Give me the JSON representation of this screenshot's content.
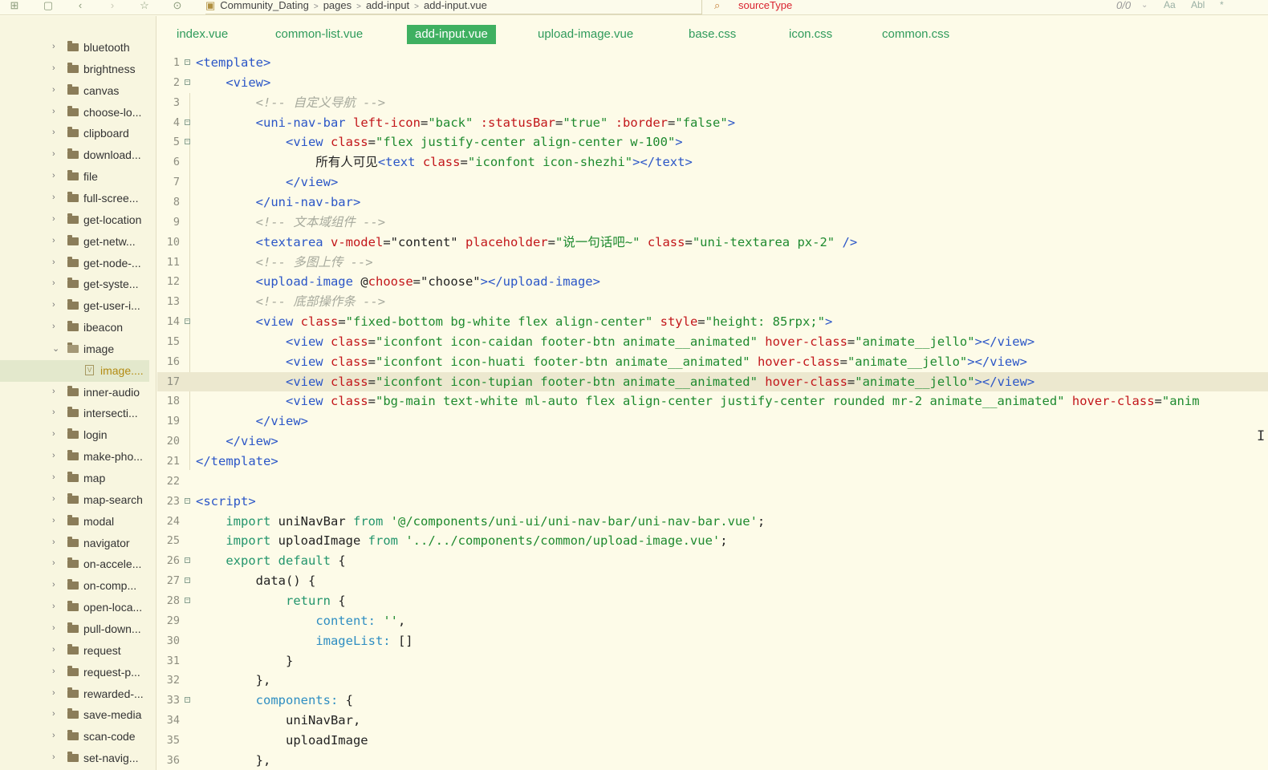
{
  "breadcrumb": [
    "Community_Dating",
    "pages",
    "add-input",
    "add-input.vue"
  ],
  "search": {
    "query": "sourceType",
    "count": "0/0",
    "options": [
      "Aa",
      "Abl",
      "*"
    ]
  },
  "sidebar": {
    "items": [
      {
        "label": "bluetooth",
        "type": "folder",
        "expanded": false
      },
      {
        "label": "brightness",
        "type": "folder",
        "expanded": false
      },
      {
        "label": "canvas",
        "type": "folder",
        "expanded": false
      },
      {
        "label": "choose-lo...",
        "type": "folder",
        "expanded": false
      },
      {
        "label": "clipboard",
        "type": "folder",
        "expanded": false
      },
      {
        "label": "download...",
        "type": "folder",
        "expanded": false
      },
      {
        "label": "file",
        "type": "folder",
        "expanded": false
      },
      {
        "label": "full-scree...",
        "type": "folder",
        "expanded": false
      },
      {
        "label": "get-location",
        "type": "folder",
        "expanded": false
      },
      {
        "label": "get-netw...",
        "type": "folder",
        "expanded": false
      },
      {
        "label": "get-node-...",
        "type": "folder",
        "expanded": false
      },
      {
        "label": "get-syste...",
        "type": "folder",
        "expanded": false
      },
      {
        "label": "get-user-i...",
        "type": "folder",
        "expanded": false
      },
      {
        "label": "ibeacon",
        "type": "folder",
        "expanded": false
      },
      {
        "label": "image",
        "type": "folder",
        "expanded": true
      },
      {
        "label": "image....",
        "type": "file",
        "selected": true
      },
      {
        "label": "inner-audio",
        "type": "folder",
        "expanded": false
      },
      {
        "label": "intersecti...",
        "type": "folder",
        "expanded": false
      },
      {
        "label": "login",
        "type": "folder",
        "expanded": false
      },
      {
        "label": "make-pho...",
        "type": "folder",
        "expanded": false
      },
      {
        "label": "map",
        "type": "folder",
        "expanded": false
      },
      {
        "label": "map-search",
        "type": "folder",
        "expanded": false
      },
      {
        "label": "modal",
        "type": "folder",
        "expanded": false
      },
      {
        "label": "navigator",
        "type": "folder",
        "expanded": false
      },
      {
        "label": "on-accele...",
        "type": "folder",
        "expanded": false
      },
      {
        "label": "on-comp...",
        "type": "folder",
        "expanded": false
      },
      {
        "label": "open-loca...",
        "type": "folder",
        "expanded": false
      },
      {
        "label": "pull-down...",
        "type": "folder",
        "expanded": false
      },
      {
        "label": "request",
        "type": "folder",
        "expanded": false
      },
      {
        "label": "request-p...",
        "type": "folder",
        "expanded": false
      },
      {
        "label": "rewarded-...",
        "type": "folder",
        "expanded": false
      },
      {
        "label": "save-media",
        "type": "folder",
        "expanded": false
      },
      {
        "label": "scan-code",
        "type": "folder",
        "expanded": false
      },
      {
        "label": "set-navig...",
        "type": "folder",
        "expanded": false
      }
    ]
  },
  "tabs": [
    {
      "label": "index.vue",
      "active": false
    },
    {
      "label": "common-list.vue",
      "active": false
    },
    {
      "label": "add-input.vue",
      "active": true
    },
    {
      "label": "upload-image.vue",
      "active": false
    },
    {
      "label": "base.css",
      "active": false
    },
    {
      "label": "icon.css",
      "active": false
    },
    {
      "label": "common.css",
      "active": false
    }
  ],
  "editor": {
    "current_line": 17,
    "lines": [
      {
        "n": "1",
        "fold": true,
        "tokens": [
          [
            "t",
            "<template>"
          ]
        ]
      },
      {
        "n": "2",
        "fold": true,
        "tokens": [
          [
            "x",
            "    "
          ],
          [
            "t",
            "<view>"
          ]
        ]
      },
      {
        "n": "3",
        "fold": false,
        "tokens": [
          [
            "x",
            "        "
          ],
          [
            "c",
            "<!-- 自定义导航 -->"
          ]
        ]
      },
      {
        "n": "4",
        "fold": true,
        "tokens": [
          [
            "x",
            "        "
          ],
          [
            "t",
            "<uni-nav-bar "
          ],
          [
            "a",
            "left-icon"
          ],
          [
            "x",
            "="
          ],
          [
            "s",
            "\"back\""
          ],
          [
            "x",
            " "
          ],
          [
            "a",
            ":statusBar"
          ],
          [
            "x",
            "="
          ],
          [
            "s",
            "\"true\""
          ],
          [
            "x",
            " "
          ],
          [
            "a",
            ":border"
          ],
          [
            "x",
            "="
          ],
          [
            "s",
            "\"false\""
          ],
          [
            "t",
            ">"
          ]
        ]
      },
      {
        "n": "5",
        "fold": true,
        "tokens": [
          [
            "x",
            "            "
          ],
          [
            "t",
            "<view "
          ],
          [
            "a",
            "class"
          ],
          [
            "x",
            "="
          ],
          [
            "s",
            "\"flex justify-center align-center w-100\""
          ],
          [
            "t",
            ">"
          ]
        ]
      },
      {
        "n": "6",
        "fold": false,
        "tokens": [
          [
            "x",
            "                所有人可见"
          ],
          [
            "t",
            "<text "
          ],
          [
            "a",
            "class"
          ],
          [
            "x",
            "="
          ],
          [
            "s",
            "\"iconfont icon-shezhi\""
          ],
          [
            "t",
            "></text>"
          ]
        ]
      },
      {
        "n": "7",
        "fold": false,
        "tokens": [
          [
            "x",
            "            "
          ],
          [
            "t",
            "</view>"
          ]
        ]
      },
      {
        "n": "8",
        "fold": false,
        "tokens": [
          [
            "x",
            "        "
          ],
          [
            "t",
            "</uni-nav-bar>"
          ]
        ]
      },
      {
        "n": "9",
        "fold": false,
        "tokens": [
          [
            "x",
            "        "
          ],
          [
            "c",
            "<!-- 文本域组件 -->"
          ]
        ]
      },
      {
        "n": "10",
        "fold": false,
        "tokens": [
          [
            "x",
            "        "
          ],
          [
            "t",
            "<textarea "
          ],
          [
            "a",
            "v-model"
          ],
          [
            "x",
            "=\"content\" "
          ],
          [
            "a",
            "placeholder"
          ],
          [
            "x",
            "="
          ],
          [
            "s",
            "\"说一句话吧~\""
          ],
          [
            "x",
            " "
          ],
          [
            "a",
            "class"
          ],
          [
            "x",
            "="
          ],
          [
            "s",
            "\"uni-textarea px-2\""
          ],
          [
            "x",
            " "
          ],
          [
            "t",
            "/>"
          ]
        ]
      },
      {
        "n": "11",
        "fold": false,
        "tokens": [
          [
            "x",
            "        "
          ],
          [
            "c",
            "<!-- 多图上传 -->"
          ]
        ]
      },
      {
        "n": "12",
        "fold": false,
        "tokens": [
          [
            "x",
            "        "
          ],
          [
            "t",
            "<upload-image "
          ],
          [
            "x",
            "@"
          ],
          [
            "a",
            "choose"
          ],
          [
            "x",
            "=\"choose\""
          ],
          [
            "t",
            "></upload-image>"
          ]
        ]
      },
      {
        "n": "13",
        "fold": false,
        "tokens": [
          [
            "x",
            "        "
          ],
          [
            "c",
            "<!-- 底部操作条 -->"
          ]
        ]
      },
      {
        "n": "14",
        "fold": true,
        "tokens": [
          [
            "x",
            "        "
          ],
          [
            "t",
            "<view "
          ],
          [
            "a",
            "class"
          ],
          [
            "x",
            "="
          ],
          [
            "s",
            "\"fixed-bottom bg-white flex align-center\""
          ],
          [
            "x",
            " "
          ],
          [
            "a",
            "style"
          ],
          [
            "x",
            "="
          ],
          [
            "s",
            "\"height: 85rpx;\""
          ],
          [
            "t",
            ">"
          ]
        ]
      },
      {
        "n": "15",
        "fold": false,
        "tokens": [
          [
            "x",
            "            "
          ],
          [
            "t",
            "<view "
          ],
          [
            "a",
            "class"
          ],
          [
            "x",
            "="
          ],
          [
            "s",
            "\"iconfont icon-caidan footer-btn animate__animated\""
          ],
          [
            "x",
            " "
          ],
          [
            "a",
            "hover-class"
          ],
          [
            "x",
            "="
          ],
          [
            "s",
            "\"animate__jello\""
          ],
          [
            "t",
            "></view>"
          ]
        ]
      },
      {
        "n": "16",
        "fold": false,
        "tokens": [
          [
            "x",
            "            "
          ],
          [
            "t",
            "<view "
          ],
          [
            "a",
            "class"
          ],
          [
            "x",
            "="
          ],
          [
            "s",
            "\"iconfont icon-huati footer-btn animate__animated\""
          ],
          [
            "x",
            " "
          ],
          [
            "a",
            "hover-class"
          ],
          [
            "x",
            "="
          ],
          [
            "s",
            "\"animate__jello\""
          ],
          [
            "t",
            "></view>"
          ]
        ]
      },
      {
        "n": "17",
        "fold": false,
        "tokens": [
          [
            "x",
            "            "
          ],
          [
            "t",
            "<view "
          ],
          [
            "a",
            "class"
          ],
          [
            "x",
            "="
          ],
          [
            "s",
            "\"iconfont icon-tupian footer-btn animate__animated\""
          ],
          [
            "x",
            " "
          ],
          [
            "a",
            "hover-class"
          ],
          [
            "x",
            "="
          ],
          [
            "s",
            "\"animate__jello\""
          ],
          [
            "t",
            "></view>"
          ]
        ]
      },
      {
        "n": "18",
        "fold": false,
        "tokens": [
          [
            "x",
            "            "
          ],
          [
            "t",
            "<view "
          ],
          [
            "a",
            "class"
          ],
          [
            "x",
            "="
          ],
          [
            "s",
            "\"bg-main text-white ml-auto flex align-center justify-center rounded mr-2 animate__animated\""
          ],
          [
            "x",
            " "
          ],
          [
            "a",
            "hover-class"
          ],
          [
            "x",
            "="
          ],
          [
            "s",
            "\"anim"
          ]
        ]
      },
      {
        "n": "19",
        "fold": false,
        "tokens": [
          [
            "x",
            "        "
          ],
          [
            "t",
            "</view>"
          ]
        ]
      },
      {
        "n": "20",
        "fold": false,
        "tokens": [
          [
            "x",
            "    "
          ],
          [
            "t",
            "</view>"
          ]
        ]
      },
      {
        "n": "21",
        "fold": false,
        "tokens": [
          [
            "t",
            "</template>"
          ]
        ]
      },
      {
        "n": "22",
        "fold": false,
        "tokens": []
      },
      {
        "n": "23",
        "fold": true,
        "tokens": [
          [
            "t",
            "<script>"
          ]
        ]
      },
      {
        "n": "24",
        "fold": false,
        "tokens": [
          [
            "x",
            "    "
          ],
          [
            "k",
            "import"
          ],
          [
            "x",
            " uniNavBar "
          ],
          [
            "k",
            "from"
          ],
          [
            "x",
            " "
          ],
          [
            "s",
            "'@/components/uni-ui/uni-nav-bar/uni-nav-bar.vue'"
          ],
          [
            "x",
            ";"
          ]
        ]
      },
      {
        "n": "25",
        "fold": false,
        "tokens": [
          [
            "x",
            "    "
          ],
          [
            "k",
            "import"
          ],
          [
            "x",
            " uploadImage "
          ],
          [
            "k",
            "from"
          ],
          [
            "x",
            " "
          ],
          [
            "s",
            "'../../components/common/upload-image.vue'"
          ],
          [
            "x",
            ";"
          ]
        ]
      },
      {
        "n": "26",
        "fold": true,
        "tokens": [
          [
            "x",
            "    "
          ],
          [
            "k",
            "export default"
          ],
          [
            "x",
            " {"
          ]
        ]
      },
      {
        "n": "27",
        "fold": true,
        "tokens": [
          [
            "x",
            "        data() {"
          ]
        ]
      },
      {
        "n": "28",
        "fold": true,
        "tokens": [
          [
            "x",
            "            "
          ],
          [
            "k",
            "return"
          ],
          [
            "x",
            " {"
          ]
        ]
      },
      {
        "n": "29",
        "fold": false,
        "tokens": [
          [
            "x",
            "                "
          ],
          [
            "p",
            "content:"
          ],
          [
            "x",
            " "
          ],
          [
            "s",
            "''"
          ],
          [
            "x",
            ","
          ]
        ]
      },
      {
        "n": "30",
        "fold": false,
        "tokens": [
          [
            "x",
            "                "
          ],
          [
            "p",
            "imageList:"
          ],
          [
            "x",
            " []"
          ]
        ]
      },
      {
        "n": "31",
        "fold": false,
        "tokens": [
          [
            "x",
            "            }"
          ]
        ]
      },
      {
        "n": "32",
        "fold": false,
        "tokens": [
          [
            "x",
            "        },"
          ]
        ]
      },
      {
        "n": "33",
        "fold": true,
        "tokens": [
          [
            "x",
            "        "
          ],
          [
            "p",
            "components:"
          ],
          [
            "x",
            " {"
          ]
        ]
      },
      {
        "n": "34",
        "fold": false,
        "tokens": [
          [
            "x",
            "            uniNavBar,"
          ]
        ]
      },
      {
        "n": "35",
        "fold": false,
        "tokens": [
          [
            "x",
            "            uploadImage"
          ]
        ]
      },
      {
        "n": "36",
        "fold": false,
        "tokens": [
          [
            "x",
            "        },"
          ]
        ]
      }
    ]
  }
}
